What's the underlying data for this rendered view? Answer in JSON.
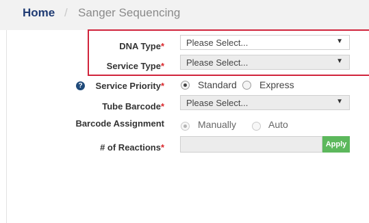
{
  "breadcrumb": {
    "home": "Home",
    "separator": "/",
    "current": "Sanger Sequencing"
  },
  "form": {
    "required_marker": "*",
    "dna_type": {
      "label": "DNA Type",
      "value": "Please Select..."
    },
    "service_type": {
      "label": "Service Type",
      "value": "Please Select..."
    },
    "service_priority": {
      "label": "Service Priority",
      "options": [
        "Standard",
        "Express"
      ],
      "selected": "Standard"
    },
    "tube_barcode": {
      "label": "Tube Barcode",
      "value": "Please Select..."
    },
    "barcode_assignment": {
      "label": "Barcode Assignment",
      "options": [
        "Manually",
        "Auto"
      ],
      "selected": "Manually"
    },
    "reactions": {
      "label": "# of Reactions",
      "value": "",
      "apply_label": "Apply"
    }
  },
  "icons": {
    "help": "question-circle-icon",
    "caret": "caret-down-icon"
  },
  "colors": {
    "highlight": "#d0223a",
    "required": "#d9262b",
    "apply": "#5cb85c",
    "home_link": "#1f3b73"
  }
}
